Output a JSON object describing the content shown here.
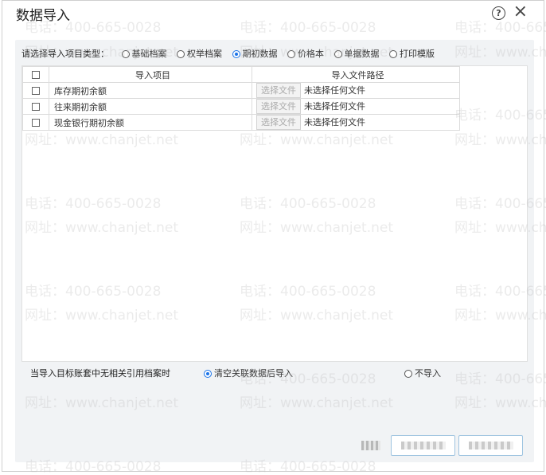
{
  "dialog": {
    "title": "数据导入",
    "help_icon": "question-circle-icon",
    "close_icon": "close-icon",
    "help_glyph": "?",
    "close_glyph": "×"
  },
  "import_type": {
    "label": "请选择导入项目类型：",
    "options": [
      {
        "label": "基础档案",
        "selected": false
      },
      {
        "label": "权举档案",
        "selected": false
      },
      {
        "label": "期初数据",
        "selected": true
      },
      {
        "label": "价格本",
        "selected": false
      },
      {
        "label": "单据数据",
        "selected": false
      },
      {
        "label": "打印模版",
        "selected": false
      }
    ]
  },
  "table": {
    "headers": {
      "item": "导入项目",
      "path": "导入文件路径"
    },
    "rows": [
      {
        "item": "库存期初余额",
        "button": "选择文件",
        "status": "未选择任何文件"
      },
      {
        "item": "往来期初余额",
        "button": "选择文件",
        "status": "未选择任何文件"
      },
      {
        "item": "现金银行期初余额",
        "button": "选择文件",
        "status": "未选择任何文件"
      }
    ]
  },
  "no_reference": {
    "label": "当导入目标账套中无相关引用档案时",
    "clear_option": {
      "label": "清空关联数据后导入",
      "selected": true
    },
    "skip_option": {
      "label": "不导入",
      "selected": false
    }
  },
  "watermark": {
    "phone": "电话：400-665-0028",
    "site": "网址：www.chanjet.net"
  },
  "colors": {
    "accent": "#1a73e8",
    "button_border": "#9fc4e0",
    "panel_bg": "#f1f3f5"
  }
}
